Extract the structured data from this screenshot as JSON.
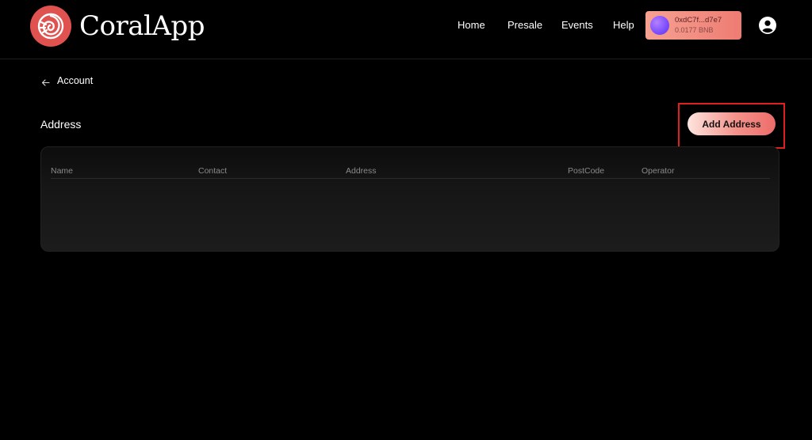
{
  "header": {
    "brand": "CoralApp",
    "nav": [
      "Home",
      "Presale",
      "Events",
      "Help"
    ],
    "wallet": {
      "address": "0xdC7f...d7e7",
      "balance": "0.0177 BNB"
    }
  },
  "page": {
    "back_label": "Account",
    "section_title": "Address",
    "add_button_label": "Add Address"
  },
  "table": {
    "columns": [
      "Name",
      "Contact",
      "Address",
      "PostCode",
      "Operator"
    ],
    "rows": []
  },
  "icons": {
    "logo": "nautilus-shell-icon",
    "back": "arrow-left-icon",
    "user": "user-circle-icon",
    "wallet_avatar": "wallet-avatar-icon"
  },
  "colors": {
    "background": "#000000",
    "brand": "#e05250",
    "accent_gradient_start": "#fde5df",
    "accent_gradient_end": "#ee6c6a",
    "highlight_border": "#e02020"
  }
}
